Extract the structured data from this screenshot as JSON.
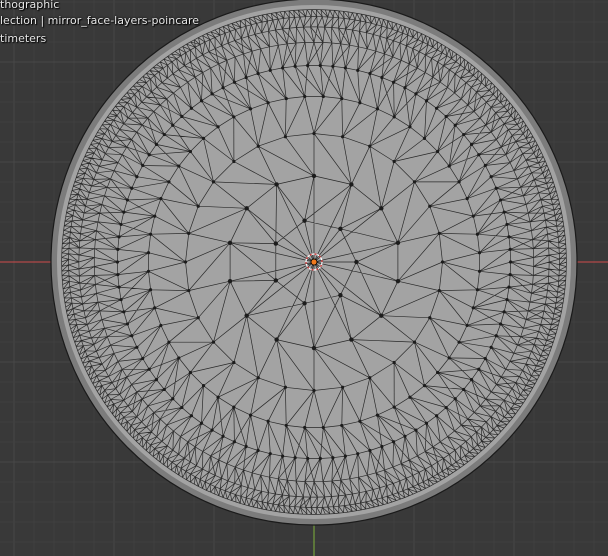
{
  "viewport": {
    "view_name": "thographic",
    "collection_label": "lection | mirror_face-layers-poincare",
    "units": "timeters"
  },
  "colors": {
    "background": "#393939",
    "grid_minor": "#404040",
    "grid_major": "#474747",
    "disk_fill": "#a3a3a3",
    "disk_border": "#1a1a1a",
    "edges": "#1c1c1c",
    "x_axis": "#d04a4a",
    "y_axis": "#7fb33a",
    "origin": "#f07a1e"
  },
  "icons": {
    "object_origin": "origin-marker-icon"
  }
}
